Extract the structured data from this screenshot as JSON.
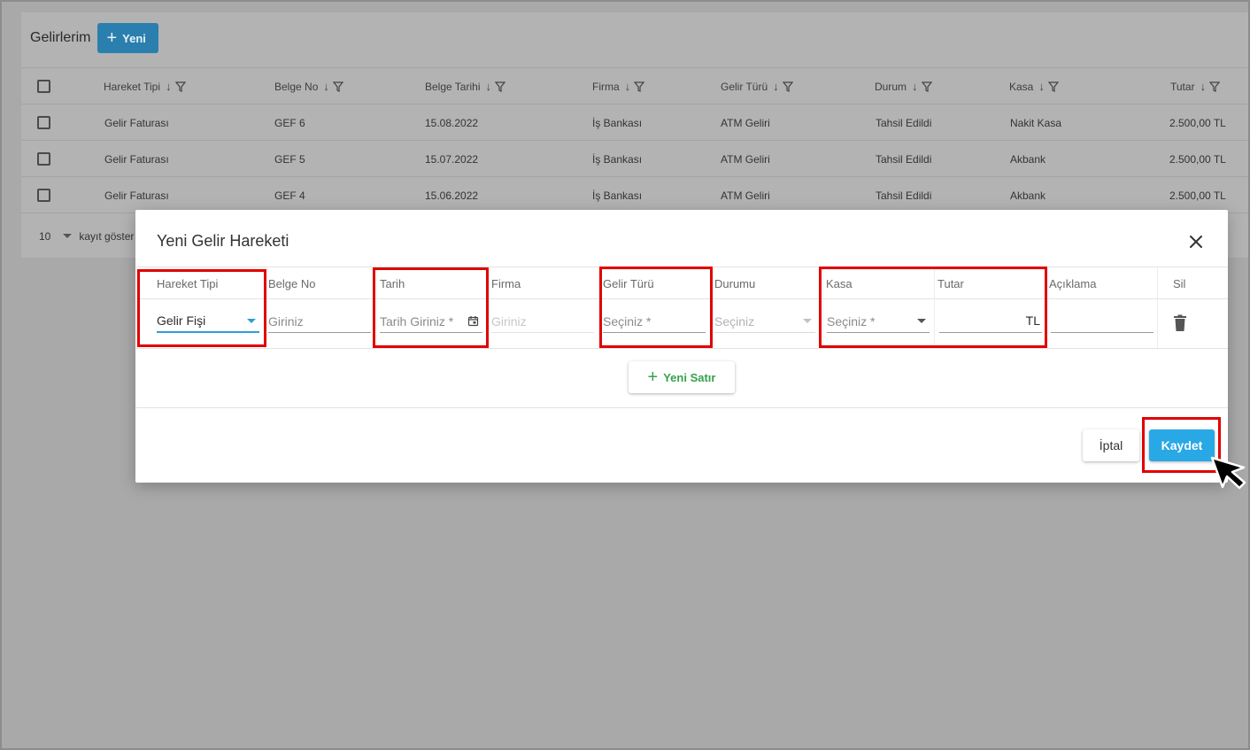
{
  "page": {
    "title": "Gelirlerim",
    "new_button": "Yeni"
  },
  "table": {
    "columns": [
      "Hareket Tipi",
      "Belge No",
      "Belge Tarihi",
      "Firma",
      "Gelir Türü",
      "Durum",
      "Kasa",
      "Tutar"
    ],
    "rows": [
      [
        "Gelir Faturası",
        "GEF 6",
        "15.08.2022",
        "İş Bankası",
        "ATM Geliri",
        "Tahsil Edildi",
        "Nakit Kasa",
        "2.500,00 TL"
      ],
      [
        "Gelir Faturası",
        "GEF 5",
        "15.07.2022",
        "İş Bankası",
        "ATM Geliri",
        "Tahsil Edildi",
        "Akbank",
        "2.500,00 TL"
      ],
      [
        "Gelir Faturası",
        "GEF 4",
        "15.06.2022",
        "İş Bankası",
        "ATM Geliri",
        "Tahsil Edildi",
        "Akbank",
        "2.500,00 TL"
      ]
    ],
    "page_size": "10",
    "page_size_label": "kayıt göster"
  },
  "modal": {
    "title": "Yeni Gelir Hareketi",
    "columns": {
      "hareket_tipi": "Hareket Tipi",
      "belge_no": "Belge No",
      "tarih": "Tarih",
      "firma": "Firma",
      "gelir_turu": "Gelir Türü",
      "durumu": "Durumu",
      "kasa": "Kasa",
      "tutar": "Tutar",
      "aciklama": "Açıklama",
      "sil": "Sil"
    },
    "row": {
      "hareket_tipi_value": "Gelir Fişi",
      "belge_no_placeholder": "Giriniz",
      "tarih_placeholder": "Tarih Giriniz *",
      "firma_placeholder": "Giriniz",
      "gelir_turu_placeholder": "Seçiniz *",
      "durumu_placeholder": "Seçiniz",
      "kasa_placeholder": "Seçiniz *",
      "tutar_currency": "TL"
    },
    "add_row_button": "Yeni Satır",
    "cancel_button": "İptal",
    "save_button": "Kaydet"
  },
  "colors": {
    "accent": "#29a8e6",
    "highlight": "#e00000",
    "add_row": "#35a24a"
  }
}
